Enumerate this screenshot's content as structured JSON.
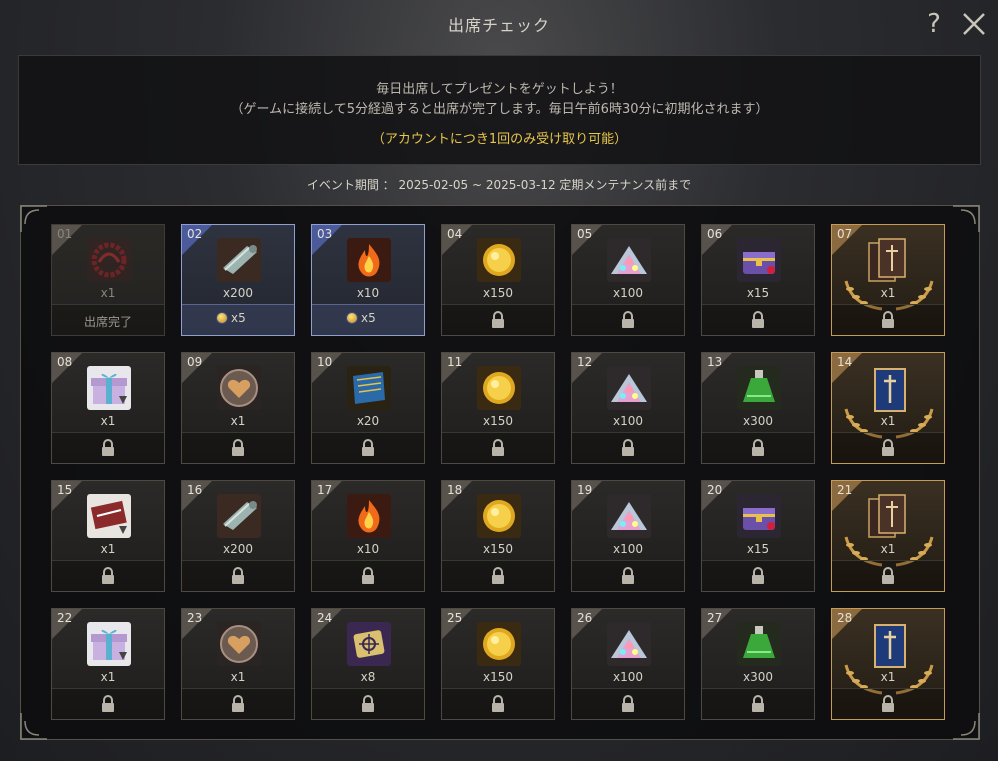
{
  "window": {
    "title": "出席チェック"
  },
  "notice": {
    "line1": "毎日出席してプレゼントをゲットしよう！",
    "line2": "（ゲームに接続して5分経過すると出席が完了します。毎日午前6時30分に初期化されます）",
    "line3": "（アカウントにつき1回のみ受け取り可能）"
  },
  "period": "イベント期間 ： 2025-02-05 ~ 2025-03-12 定期メンテナンス前まで",
  "help_label": "?",
  "days": [
    {
      "num": "01",
      "icon": "red-ribbon-icon",
      "qty": "x1",
      "state": "claimed",
      "status": "出席完了"
    },
    {
      "num": "02",
      "icon": "scroll-icon",
      "qty": "x200",
      "state": "today",
      "bonus": "x5"
    },
    {
      "num": "03",
      "icon": "flame-icon",
      "qty": "x10",
      "state": "today",
      "bonus": "x5"
    },
    {
      "num": "04",
      "icon": "gold-coin-icon",
      "qty": "x150",
      "state": "locked"
    },
    {
      "num": "05",
      "icon": "rainbow-crystal-icon",
      "qty": "x100",
      "state": "locked"
    },
    {
      "num": "06",
      "icon": "treasure-chest-icon",
      "qty": "x15",
      "state": "locked"
    },
    {
      "num": "07",
      "icon": "card-pack-icon",
      "qty": "x1",
      "state": "special"
    },
    {
      "num": "08",
      "icon": "gift-box-icon",
      "qty": "x1",
      "state": "locked"
    },
    {
      "num": "09",
      "icon": "heart-medal-icon",
      "qty": "x1",
      "state": "locked"
    },
    {
      "num": "10",
      "icon": "blue-map-icon",
      "qty": "x20",
      "state": "locked"
    },
    {
      "num": "11",
      "icon": "gold-coin-icon",
      "qty": "x150",
      "state": "locked"
    },
    {
      "num": "12",
      "icon": "rainbow-crystal-icon",
      "qty": "x100",
      "state": "locked"
    },
    {
      "num": "13",
      "icon": "green-potion-icon",
      "qty": "x300",
      "state": "locked"
    },
    {
      "num": "14",
      "icon": "blue-card-icon",
      "qty": "x1",
      "state": "special"
    },
    {
      "num": "15",
      "icon": "ticket-icon",
      "qty": "x1",
      "state": "locked"
    },
    {
      "num": "16",
      "icon": "scroll-icon",
      "qty": "x200",
      "state": "locked"
    },
    {
      "num": "17",
      "icon": "flame-icon",
      "qty": "x10",
      "state": "locked"
    },
    {
      "num": "18",
      "icon": "gold-coin-icon",
      "qty": "x150",
      "state": "locked"
    },
    {
      "num": "19",
      "icon": "rainbow-crystal-icon",
      "qty": "x100",
      "state": "locked"
    },
    {
      "num": "20",
      "icon": "treasure-chest-icon",
      "qty": "x15",
      "state": "locked"
    },
    {
      "num": "21",
      "icon": "card-pack-icon",
      "qty": "x1",
      "state": "special"
    },
    {
      "num": "22",
      "icon": "gift-box-icon",
      "qty": "x1",
      "state": "locked"
    },
    {
      "num": "23",
      "icon": "heart-medal-icon",
      "qty": "x1",
      "state": "locked"
    },
    {
      "num": "24",
      "icon": "rune-stone-icon",
      "qty": "x8",
      "state": "locked"
    },
    {
      "num": "25",
      "icon": "gold-coin-icon",
      "qty": "x150",
      "state": "locked"
    },
    {
      "num": "26",
      "icon": "rainbow-crystal-icon",
      "qty": "x100",
      "state": "locked"
    },
    {
      "num": "27",
      "icon": "green-potion-icon",
      "qty": "x300",
      "state": "locked"
    },
    {
      "num": "28",
      "icon": "blue-card-icon",
      "qty": "x1",
      "state": "special"
    }
  ]
}
